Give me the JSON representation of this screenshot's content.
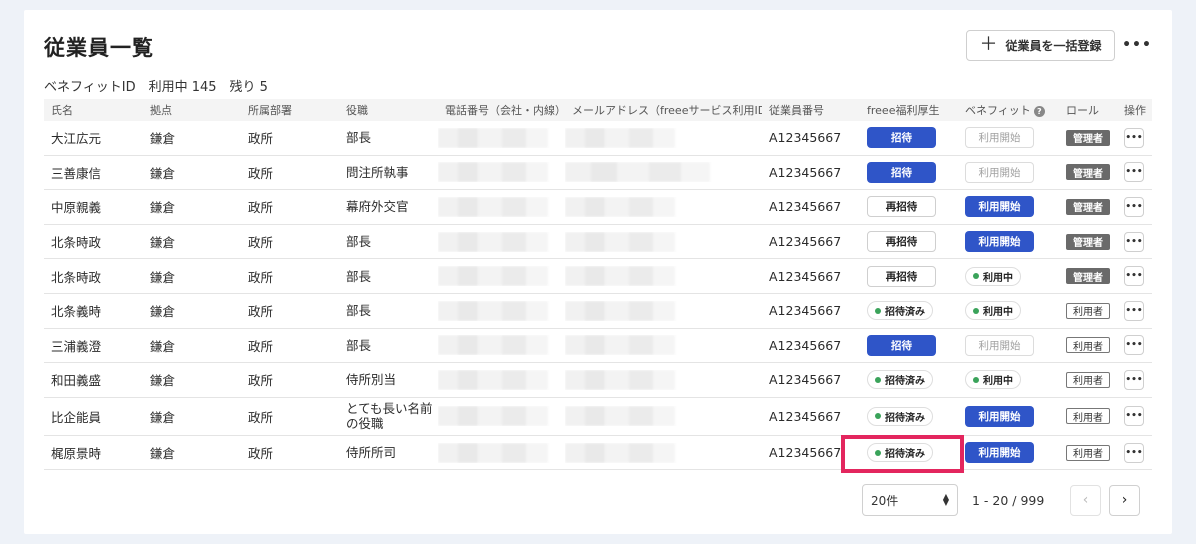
{
  "header": {
    "title": "従業員一覧",
    "summary": "ベネフィットID　利用中 145　残り 5",
    "bulk_register_label": "従業員を一括登録",
    "more_label": "•••"
  },
  "columns": [
    "氏名",
    "拠点",
    "所属部署",
    "役職",
    "電話番号（会社・内線）",
    "メールアドレス（freeeサービス利用ID）",
    "従業員番号",
    "freee福利厚生",
    "ベネフィット",
    "ロール",
    "操作"
  ],
  "rows": [
    {
      "name": "大江広元",
      "base": "鎌倉",
      "dept": "政所",
      "role": "部長",
      "emp_id": "A12345667",
      "invite": "招待",
      "invite_style": "blue",
      "benefit": "利用開始",
      "benefit_style": "disabled",
      "role_label": "管理者",
      "role_style": "dark"
    },
    {
      "name": "三善康信",
      "base": "鎌倉",
      "dept": "政所",
      "role": "問注所執事",
      "emp_id": "A12345667",
      "invite": "招待",
      "invite_style": "blue",
      "benefit": "利用開始",
      "benefit_style": "disabled",
      "role_label": "管理者",
      "role_style": "dark"
    },
    {
      "name": "中原親義",
      "base": "鎌倉",
      "dept": "政所",
      "role": "幕府外交官",
      "emp_id": "A12345667",
      "invite": "再招待",
      "invite_style": "white",
      "benefit": "利用開始",
      "benefit_style": "blue",
      "role_label": "管理者",
      "role_style": "dark"
    },
    {
      "name": "北条時政",
      "base": "鎌倉",
      "dept": "政所",
      "role": "部長",
      "emp_id": "A12345667",
      "invite": "再招待",
      "invite_style": "white",
      "benefit": "利用開始",
      "benefit_style": "blue",
      "role_label": "管理者",
      "role_style": "dark"
    },
    {
      "name": "北条時政",
      "base": "鎌倉",
      "dept": "政所",
      "role": "部長",
      "emp_id": "A12345667",
      "invite": "再招待",
      "invite_style": "white",
      "benefit": "利用中",
      "benefit_style": "pill",
      "role_label": "管理者",
      "role_style": "dark"
    },
    {
      "name": "北条義時",
      "base": "鎌倉",
      "dept": "政所",
      "role": "部長",
      "emp_id": "A12345667",
      "invite": "招待済み",
      "invite_style": "pill",
      "benefit": "利用中",
      "benefit_style": "pill",
      "role_label": "利用者",
      "role_style": "light"
    },
    {
      "name": "三浦義澄",
      "base": "鎌倉",
      "dept": "政所",
      "role": "部長",
      "emp_id": "A12345667",
      "invite": "招待",
      "invite_style": "blue",
      "benefit": "利用開始",
      "benefit_style": "disabled",
      "role_label": "利用者",
      "role_style": "light"
    },
    {
      "name": "和田義盛",
      "base": "鎌倉",
      "dept": "政所",
      "role": "侍所別当",
      "emp_id": "A12345667",
      "invite": "招待済み",
      "invite_style": "pill",
      "benefit": "利用中",
      "benefit_style": "pill",
      "role_label": "利用者",
      "role_style": "light"
    },
    {
      "name": "比企能員",
      "base": "鎌倉",
      "dept": "政所",
      "role": "とても長い名前の役職",
      "emp_id": "A12345667",
      "invite": "招待済み",
      "invite_style": "pill",
      "benefit": "利用開始",
      "benefit_style": "blue",
      "role_label": "利用者",
      "role_style": "light"
    },
    {
      "name": "梶原景時",
      "base": "鎌倉",
      "dept": "政所",
      "role": "侍所所司",
      "emp_id": "A12345667",
      "invite": "招待済み",
      "invite_style": "pill",
      "benefit": "利用開始",
      "benefit_style": "blue",
      "role_label": "利用者",
      "role_style": "light"
    }
  ],
  "pagination": {
    "per_page": "20件",
    "range": "1 - 20 / 999",
    "prev_icon": "chevron-left-icon",
    "next_icon": "chevron-right-icon"
  },
  "colors": {
    "primary": "#2f55c8",
    "highlight": "#e3265e",
    "status_dot": "#3aa35a",
    "admin_tag": "#6a6a6a",
    "background": "#eef2f8"
  }
}
